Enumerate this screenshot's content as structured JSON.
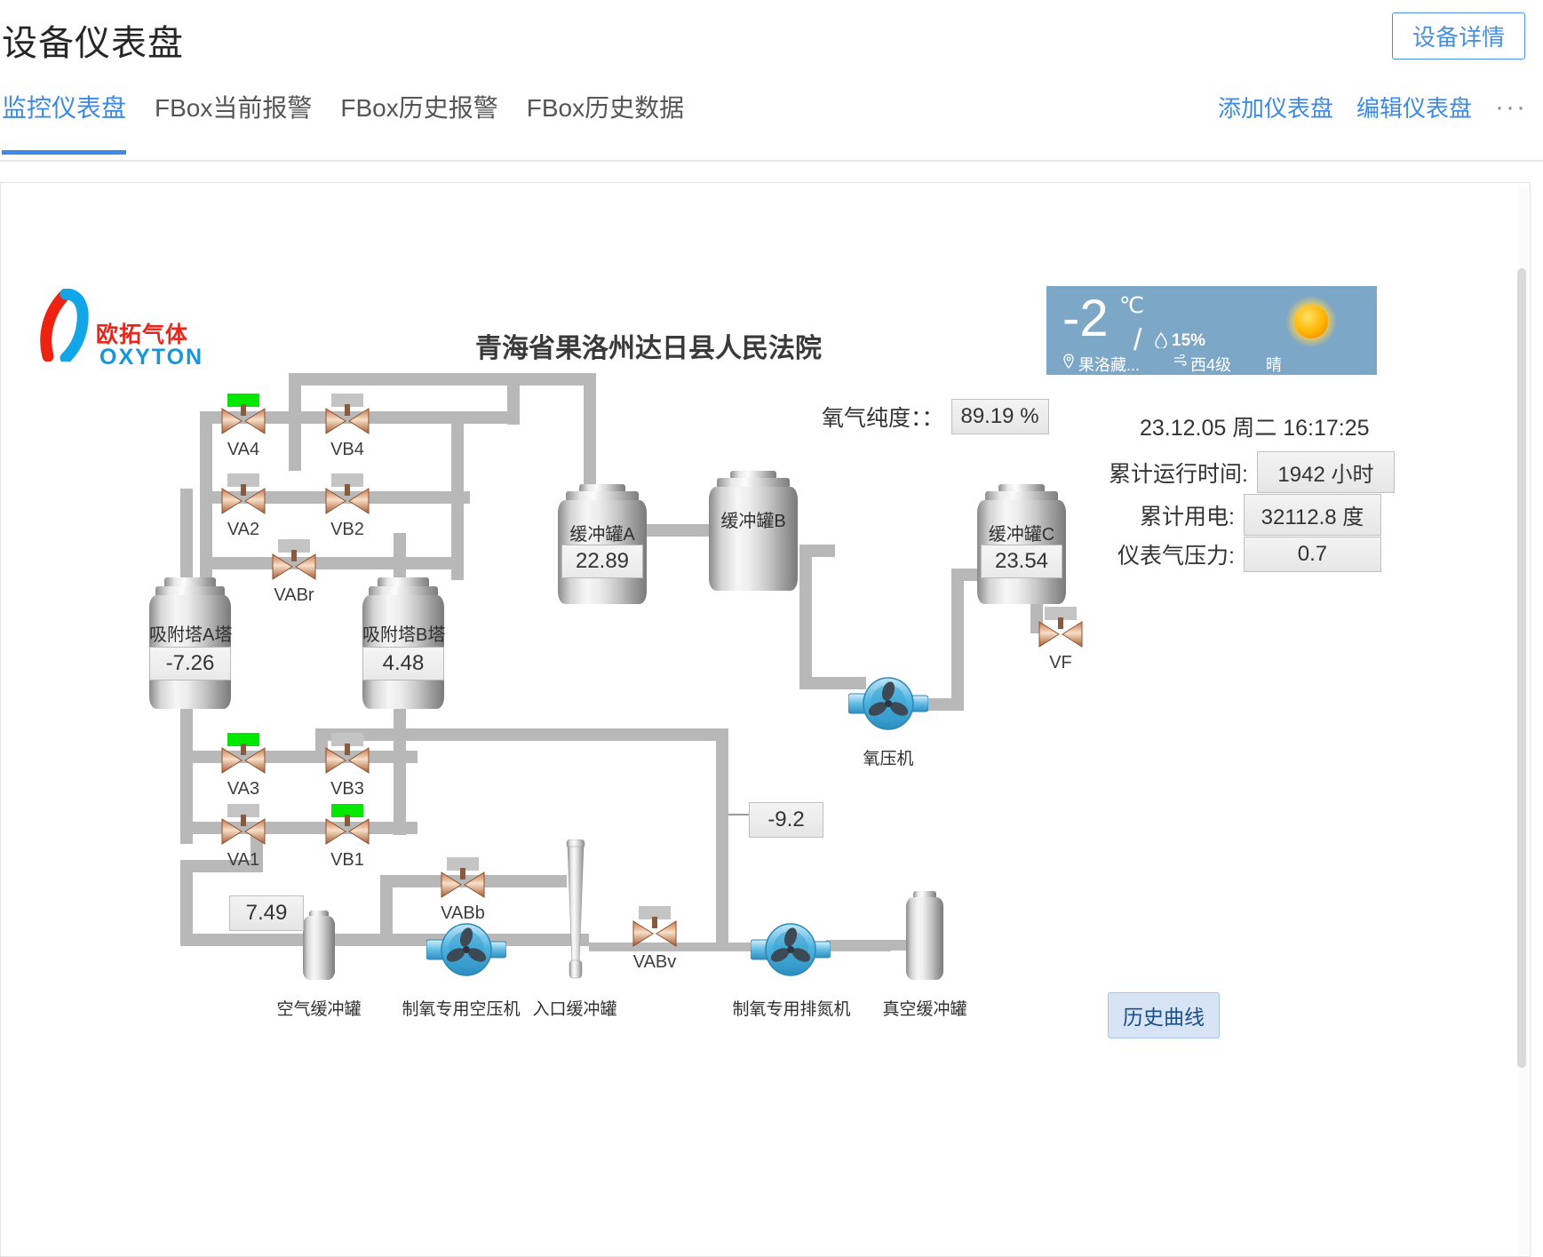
{
  "header": {
    "title": "设备仪表盘",
    "device_detail_label": "设备详情"
  },
  "tabs": [
    {
      "label": "监控仪表盘",
      "active": true
    },
    {
      "label": "FBox当前报警",
      "active": false
    },
    {
      "label": "FBox历史报警",
      "active": false
    },
    {
      "label": "FBox历史数据",
      "active": false
    }
  ],
  "tab_actions": {
    "add_dashboard": "添加仪表盘",
    "edit_dashboard": "编辑仪表盘",
    "more": "···"
  },
  "logo": {
    "cn": "欧拓气体",
    "en": "OXYTON",
    "red": "#e8261c",
    "blue": "#1596dd"
  },
  "plant": {
    "title": "青海省果洛州达日县人民法院"
  },
  "purity": {
    "label": "氧气纯度：：",
    "value": "89.19 %"
  },
  "weather": {
    "temp": "-2",
    "unit": "℃",
    "slash": "/",
    "humidity_icon": "💧",
    "humidity": "15%",
    "location_icon": "◎",
    "location": "果洛藏...",
    "wind_icon": "≈",
    "wind": "西4级",
    "condition": "晴",
    "sun_icon": "sun-icon",
    "bg": "#7da7c7"
  },
  "stats": {
    "timestamp": "23.12.05 周二 16:17:25",
    "runtime_label": "累计运行时间:",
    "runtime_value": "1942 小时",
    "power_label": "累计用电:",
    "power_value": "32112.8 度",
    "pressure_label": "仪表气压力:",
    "pressure_value": "0.7"
  },
  "valves": [
    {
      "id": "VA4",
      "label": "VA4",
      "open": true
    },
    {
      "id": "VB4",
      "label": "VB4",
      "open": false
    },
    {
      "id": "VA2",
      "label": "VA2",
      "open": false
    },
    {
      "id": "VB2",
      "label": "VB2",
      "open": false
    },
    {
      "id": "VABr",
      "label": "VABr",
      "open": false
    },
    {
      "id": "VA3",
      "label": "VA3",
      "open": true
    },
    {
      "id": "VB3",
      "label": "VB3",
      "open": false
    },
    {
      "id": "VA1",
      "label": "VA1",
      "open": false
    },
    {
      "id": "VB1",
      "label": "VB1",
      "open": true
    },
    {
      "id": "VABb",
      "label": "VABb",
      "open": false
    },
    {
      "id": "VABv",
      "label": "VABv",
      "open": false
    },
    {
      "id": "VF",
      "label": "VF",
      "open": false
    }
  ],
  "vessels": {
    "tower_a": {
      "name": "吸附塔A塔",
      "value": "-7.26"
    },
    "tower_b": {
      "name": "吸附塔B塔",
      "value": "4.48"
    },
    "buffer_a": {
      "name": "缓冲罐A",
      "value": "22.89"
    },
    "buffer_b": {
      "name": "缓冲罐B",
      "value": ""
    },
    "buffer_c": {
      "name": "缓冲罐C",
      "value": "23.54"
    },
    "air_buffer": {
      "name": "空气缓冲罐"
    },
    "inlet_buffer": {
      "name": "入口缓冲罐"
    },
    "vacuum_buffer": {
      "name": "真空缓冲罐"
    }
  },
  "machines": {
    "oxygen_compressor": "氧压机",
    "air_compressor": "制氧专用空压机",
    "nitrogen_blower": "制氧专用排氮机"
  },
  "readouts": {
    "air_pressure": "7.49",
    "vacuum_pressure": "-9.2"
  },
  "buttons": {
    "history_curve": "历史曲线"
  }
}
